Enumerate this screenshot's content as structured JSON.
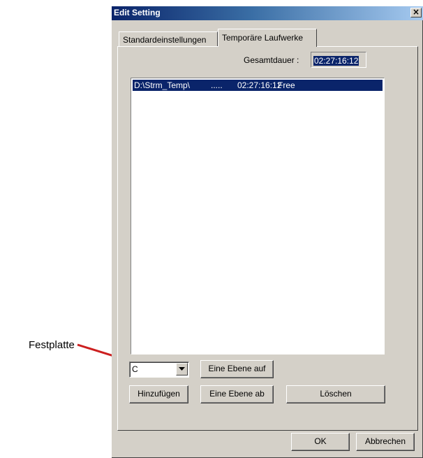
{
  "window": {
    "title": "Edit Setting",
    "close_glyph": "×"
  },
  "tabs": [
    {
      "label": "Standardeinstellungen",
      "active": false
    },
    {
      "label": "Temporäre Laufwerke",
      "active": true
    }
  ],
  "total": {
    "label": "Gesamtdauer :",
    "value": "02:27:16:12"
  },
  "drive_list": {
    "rows": [
      {
        "path": "D:\\Strm_Temp\\",
        "dots": ".....",
        "time": "02:27:16:12",
        "free": "Free",
        "selected": true
      }
    ]
  },
  "drive_combo": {
    "value": "C"
  },
  "buttons": {
    "level_up": "Eine Ebene auf",
    "level_down": "Eine Ebene ab",
    "add": "Hinzufügen",
    "delete": "Löschen",
    "ok": "OK",
    "cancel": "Abbrechen"
  },
  "annotation": {
    "label": "Festplatte",
    "color": "#cc1f1f"
  },
  "colors": {
    "titlebar_start": "#0a246a",
    "titlebar_end": "#a6caf0",
    "selection": "#0a246a",
    "dialog_face": "#d4d0c8"
  },
  "icons": {
    "dropdown": "triangle-down-icon",
    "close": "close-icon",
    "annotation_arrow": "arrow-icon"
  }
}
